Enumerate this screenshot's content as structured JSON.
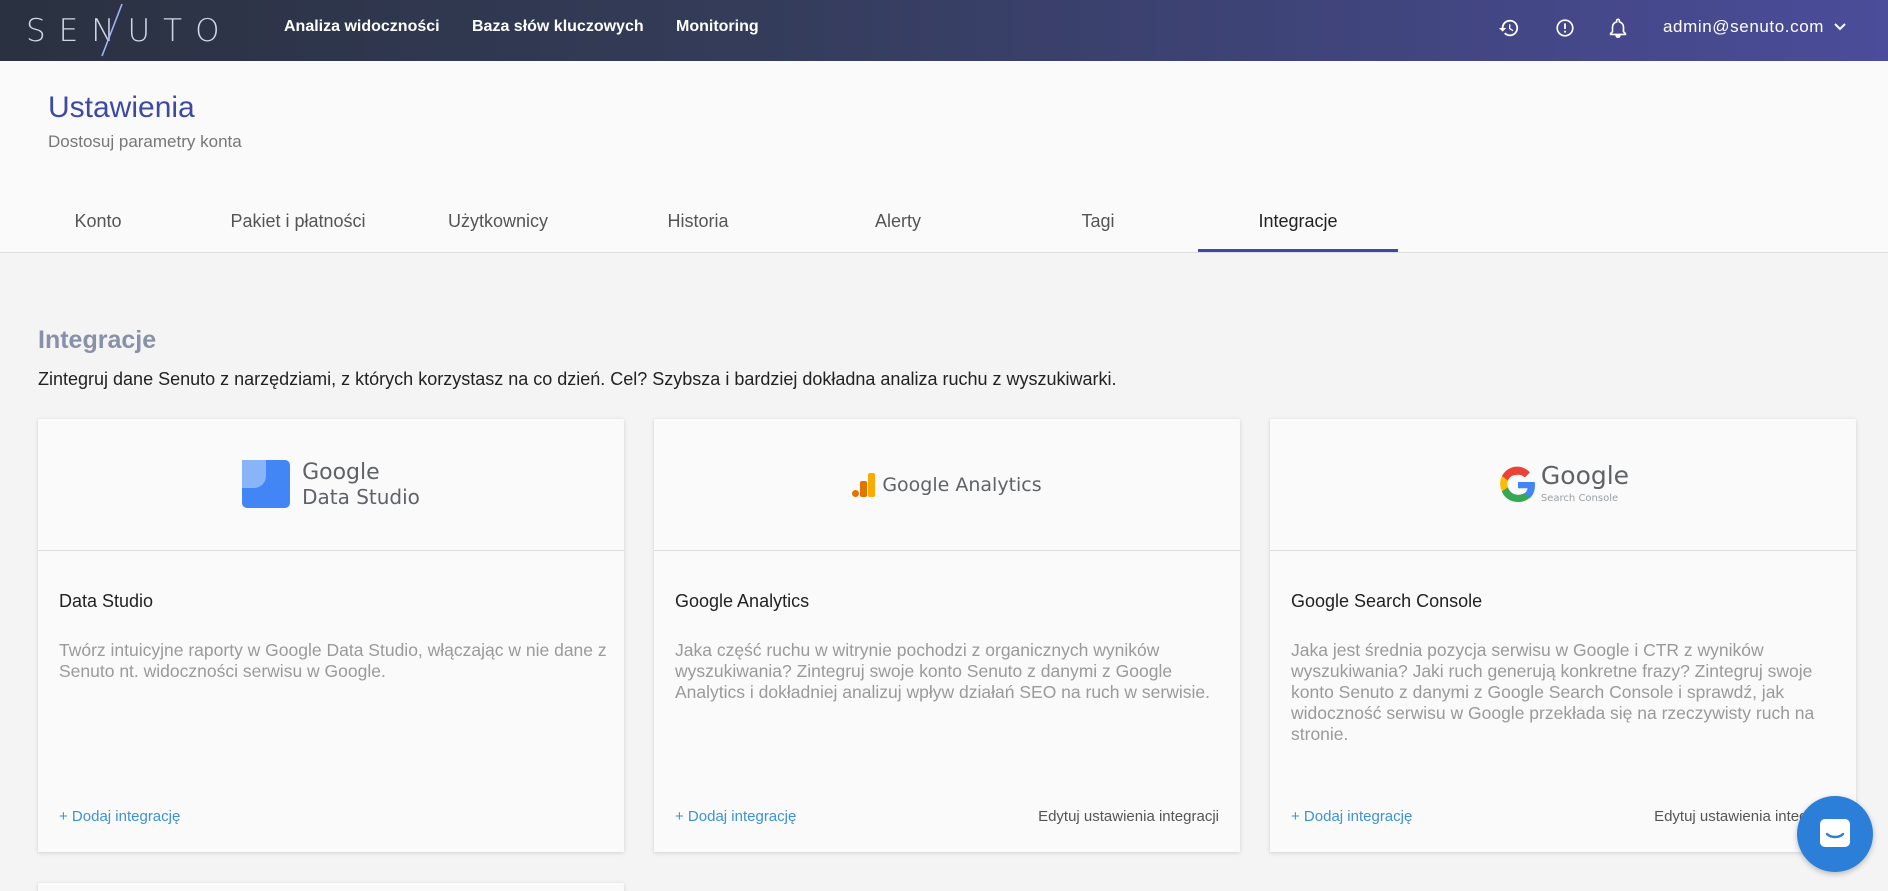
{
  "brand": {
    "logo_text": "SENUTO"
  },
  "nav": {
    "links": [
      "Analiza widoczności",
      "Baza słów kluczowych",
      "Monitoring"
    ],
    "icons": [
      "history-icon",
      "info-icon",
      "bell-icon"
    ],
    "user": "admin@senuto.com"
  },
  "header": {
    "title": "Ustawienia",
    "subtitle": "Dostosuj parametry konta"
  },
  "tabs": [
    {
      "label": "Konto",
      "active": false
    },
    {
      "label": "Pakiet i płatności",
      "active": false
    },
    {
      "label": "Użytkownicy",
      "active": false
    },
    {
      "label": "Historia",
      "active": false
    },
    {
      "label": "Alerty",
      "active": false
    },
    {
      "label": "Tagi",
      "active": false
    },
    {
      "label": "Integracje",
      "active": true
    }
  ],
  "section": {
    "title": "Integracje",
    "description": "Zintegruj dane Senuto z narzędziami, z których korzystasz na co dzień. Cel? Szybsza i bardziej dokładna analiza ruchu z wyszukiwarki."
  },
  "cards": [
    {
      "logo": {
        "line1": "Google",
        "line2": "Data Studio"
      },
      "title": "Data Studio",
      "description": "Twórz intuicyjne raporty w Google Data Studio, włączając w nie dane z Senuto nt. widoczności serwisu w Google.",
      "add_label": "+ Dodaj integrację",
      "edit_label": ""
    },
    {
      "logo": {
        "line1": "Google Analytics"
      },
      "title": "Google Analytics",
      "description": "Jaka część ruchu w witrynie pochodzi z organicznych wyników wyszukiwania? Zintegruj swoje konto Senuto z danymi z Google Analytics i dokładniej analizuj wpływ działań SEO na ruch w serwisie.",
      "add_label": "+ Dodaj integrację",
      "edit_label": "Edytuj ustawienia integracji"
    },
    {
      "logo": {
        "line1": "Google",
        "line2": "Search Console"
      },
      "title": "Google Search Console",
      "description": "Jaka jest średnia pozycja serwisu w Google i CTR z wyników wyszukiwania? Jaki ruch generują konkretne frazy? Zintegruj swoje konto Senuto z danymi z Google Search Console i sprawdź, jak widoczność serwisu w Google przekłada się na rzeczywisty ruch na stronie.",
      "add_label": "+ Dodaj integrację",
      "edit_label": "Edytuj ustawienia integracji"
    }
  ],
  "colors": {
    "accent": "#3d4aa3",
    "link": "#3b92d8",
    "chat": "#2b7fd9"
  }
}
